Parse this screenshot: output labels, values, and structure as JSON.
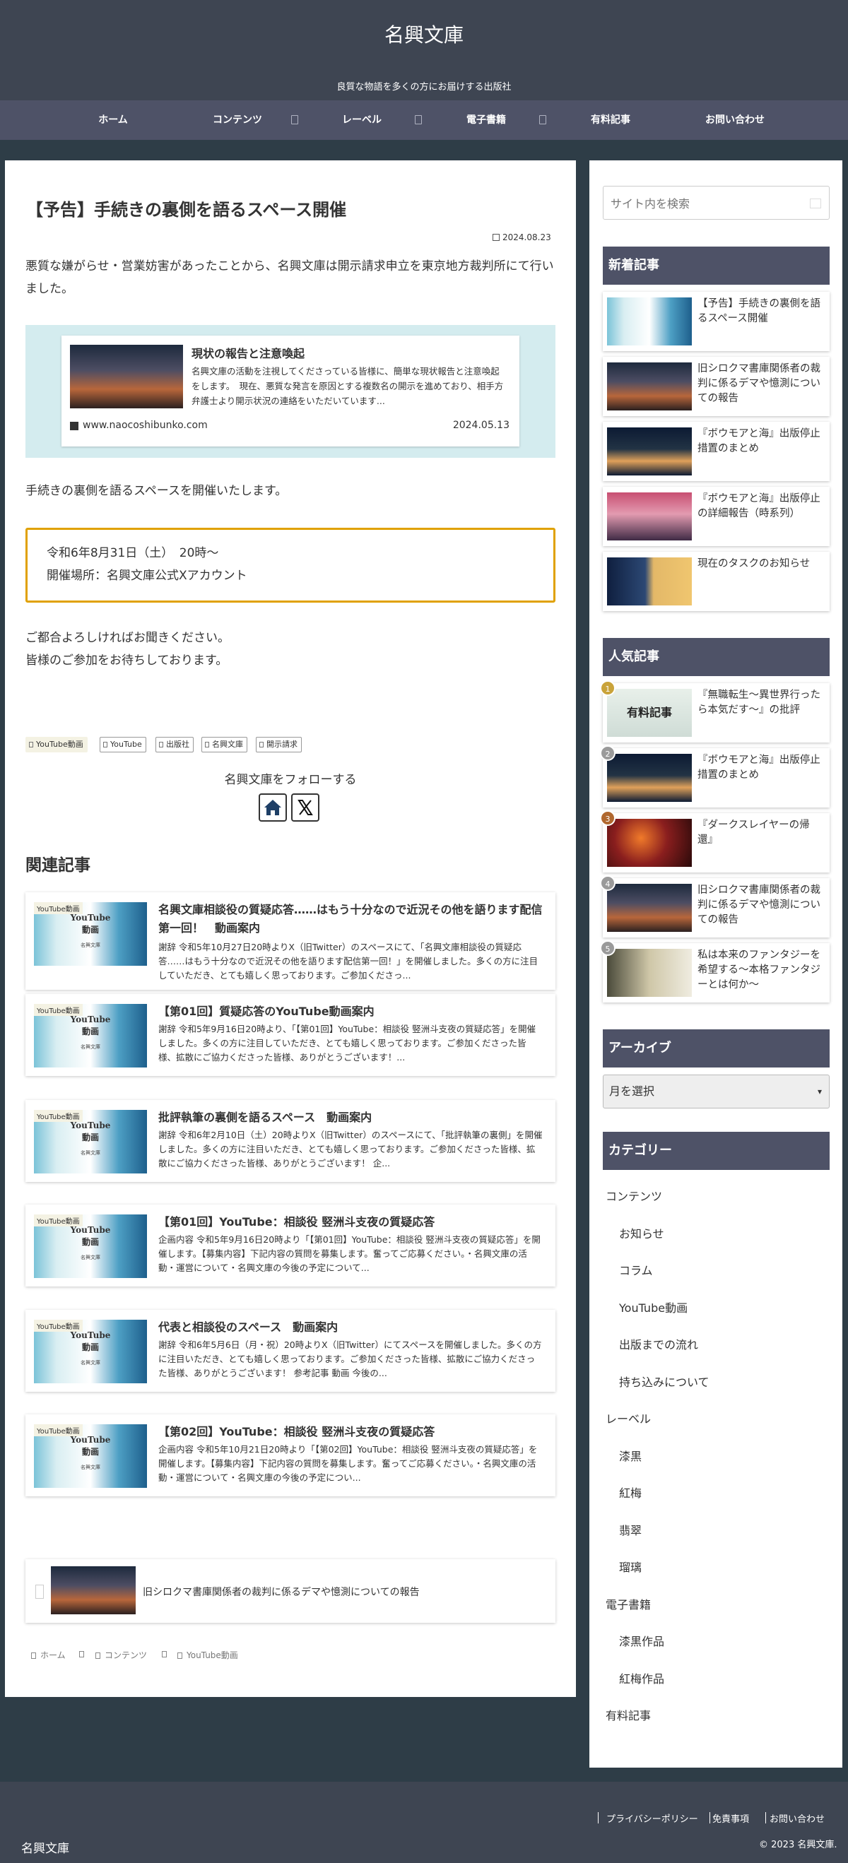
{
  "header": {
    "site_title": "名興文庫",
    "tagline": "良質な物語を多くの方にお届けする出版社"
  },
  "nav": {
    "items": [
      "ホーム",
      "コンテンツ",
      "レーベル",
      "電子書籍",
      "有料記事",
      "お問い合わせ"
    ]
  },
  "post": {
    "title": "【予告】手続きの裏側を語るスペース開催",
    "date": "2024.08.23",
    "intro": "悪質な嫌がらせ・営業妨害があったことから、名興文庫は開示請求申立を東京地方裁判所にて行いました。",
    "embed": {
      "title": "現状の報告と注意喚起",
      "excerpt": "名興文庫の活動を注視してくださっている皆様に、簡単な現状報告と注意喚起をします。　現在、悪質な発言を原因とする複数名の開示を進めており、相手方弁護士より開示状況の連絡をいただいています...",
      "domain": "www.naocoshibunko.com",
      "date": "2024.05.13"
    },
    "announce": "手続きの裏側を語るスペースを開催いたします。",
    "notice": {
      "line1": "令和6年8月31日（土）　20時〜",
      "line2": "開催場所：名興文庫公式Xアカウント"
    },
    "closing1": "ご都合よろしければお聞きください。",
    "closing2": "皆様のご参加をお待ちしております。",
    "tags": [
      "YouTube動画",
      "YouTube",
      "出版社",
      "名興文庫",
      "開示請求"
    ],
    "follow_label": "名興文庫をフォローする"
  },
  "related": {
    "heading": "関連記事",
    "category_label": "YouTube動画",
    "thumb_title": "YouTube\n動画",
    "thumb_sub": "名興文庫",
    "items": [
      {
        "title": "名興文庫相談役の質疑応答……はもう十分なので近況その他を語ります配信第一回！　動画案内",
        "snippet": "謝辞 令和5年10月27日20時よりX（旧Twitter）のスペースにて、「名興文庫相談役の質疑応答……はもう十分なので近況その他を語ります配信第一回！」を開催しました。多くの方に注目していただき、とても嬉しく思っております。ご参加くださっ..."
      },
      {
        "title": "【第01回】質疑応答のYouTube動画案内",
        "snippet": "謝辞 令和5年9月16日20時より、「【第01回】YouTube：相談役 竪洲斗支夜の質疑応答」を開催しました。多くの方に注目していただき、とても嬉しく思っております。ご参加くださった皆様、拡散にご協力くださった皆様、ありがとうございます！..."
      },
      {
        "title": "批評執筆の裏側を語るスペース　動画案内",
        "snippet": "謝辞 令和6年2月10日（土）20時よりX（旧Twitter）のスペースにて、「批評執筆の裏側」を開催しました。多くの方に注目いただき、とても嬉しく思っております。ご参加くださった皆様、拡散にご協力くださった皆様、ありがとうございます！ 企..."
      },
      {
        "title": "【第01回】YouTube：相談役 竪洲斗支夜の質疑応答",
        "snippet": "企画内容 令和5年9月16日20時より「【第01回】YouTube：相談役 竪洲斗支夜の質疑応答」を開催します。【募集内容】下記内容の質問を募集します。奮ってご応募ください。・名興文庫の活動・運営について・名興文庫の今後の予定について..."
      },
      {
        "title": "代表と相談役のスペース　動画案内",
        "snippet": "謝辞 令和6年5月6日（月・祝）20時よりX（旧Twitter）にてスペースを開催しました。多くの方に注目いただき、とても嬉しく思っております。ご参加くださった皆様、拡散にご協力くださった皆様、ありがとうございます！ 参考記事 動画 今後の..."
      },
      {
        "title": "【第02回】YouTube：相談役 竪洲斗支夜の質疑応答",
        "snippet": "企画内容 令和5年10月21日20時より「【第02回】YouTube：相談役 竪洲斗支夜の質疑応答」を開催します。【募集内容】下記内容の質問を募集します。奮ってご応募ください。・名興文庫の活動・運営について・名興文庫の今後の予定につい..."
      }
    ]
  },
  "prev_post": {
    "title": "旧シロクマ書庫関係者の裁判に係るデマや憶測についての報告"
  },
  "breadcrumb": [
    "ホーム",
    "コンテンツ",
    "YouTube動画"
  ],
  "sidebar": {
    "search_placeholder": "サイト内を検索",
    "new_heading": "新着記事",
    "new_posts": [
      {
        "title": "【予告】手続きの裏側を語るスペース開催"
      },
      {
        "title": "旧シロクマ書庫関係者の裁判に係るデマや憶測についての報告"
      },
      {
        "title": "『ボウモアと海』出版停止措置のまとめ"
      },
      {
        "title": "『ボウモアと海』出版停止の詳細報告（時系列）"
      },
      {
        "title": "現在のタスクのお知らせ"
      }
    ],
    "popular_heading": "人気記事",
    "popular_posts": [
      {
        "rank": "1",
        "title": "『無職転生〜異世界行ったら本気だす〜』の批評"
      },
      {
        "rank": "2",
        "title": "『ボウモアと海』出版停止措置のまとめ"
      },
      {
        "rank": "3",
        "title": "『ダークスレイヤーの帰還』"
      },
      {
        "rank": "4",
        "title": "旧シロクマ書庫関係者の裁判に係るデマや憶測についての報告"
      },
      {
        "rank": "5",
        "title": "私は本来のファンタジーを希望する〜本格ファンタジーとは何か〜"
      }
    ],
    "paid_thumb_text": "有料記事",
    "archive_heading": "アーカイブ",
    "archive_select": "月を選択",
    "category_heading": "カテゴリー",
    "categories": [
      "コンテンツ",
      "お知らせ",
      "コラム",
      "YouTube動画",
      "出版までの流れ",
      "持ち込みについて",
      "レーベル",
      "漆黒",
      "紅梅",
      "翡翠",
      "瑠璃",
      "電子書籍",
      "漆黒作品",
      "紅梅作品",
      "有料記事"
    ]
  },
  "footer": {
    "links": [
      "プライバシーポリシー",
      "免責事項",
      "お問い合わせ"
    ],
    "copyright": "© 2023 名興文庫.",
    "site_name": "名興文庫"
  }
}
